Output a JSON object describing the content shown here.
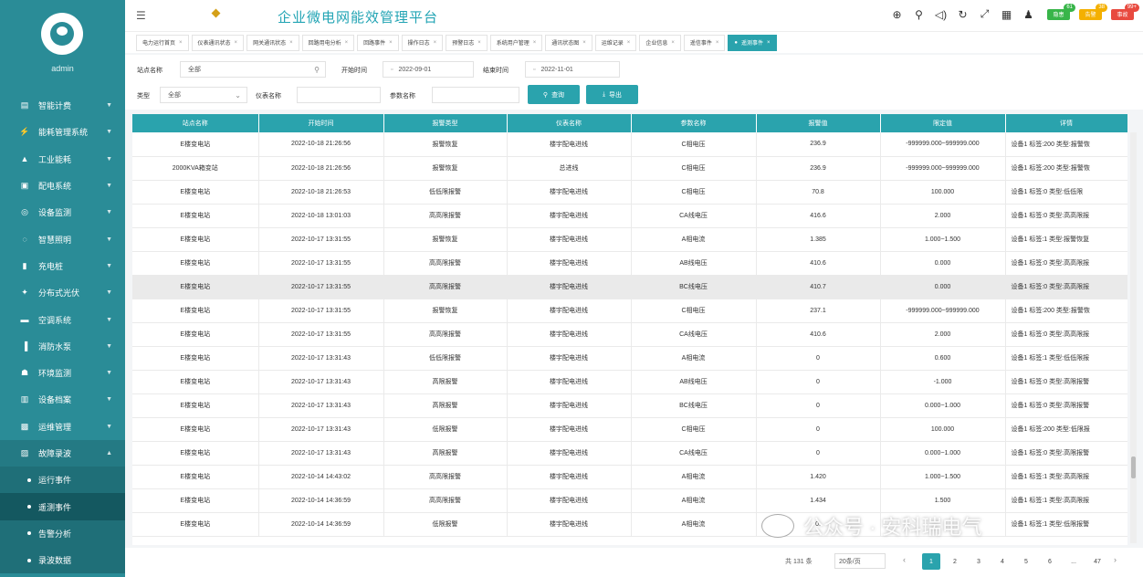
{
  "sidebar": {
    "username": "admin",
    "items": [
      {
        "label": "智能计费",
        "icon": "chart-icon"
      },
      {
        "label": "能耗管理系统",
        "icon": "bolt-icon"
      },
      {
        "label": "工业能耗",
        "icon": "factory-icon"
      },
      {
        "label": "配电系统",
        "icon": "grid-icon"
      },
      {
        "label": "设备监测",
        "icon": "monitor-icon"
      },
      {
        "label": "智慧照明",
        "icon": "bulb-icon"
      },
      {
        "label": "充电桩",
        "icon": "charger-icon"
      },
      {
        "label": "分布式光伏",
        "icon": "solar-icon"
      },
      {
        "label": "空调系统",
        "icon": "aircon-icon"
      },
      {
        "label": "消防水泵",
        "icon": "pump-icon"
      },
      {
        "label": "环境监测",
        "icon": "env-icon"
      },
      {
        "label": "设备档案",
        "icon": "archive-icon"
      },
      {
        "label": "运维管理",
        "icon": "wrench-icon"
      },
      {
        "label": "故障录波",
        "icon": "wave-icon"
      }
    ],
    "sub_items": [
      {
        "label": "运行事件"
      },
      {
        "label": "遥测事件"
      },
      {
        "label": "告警分析"
      },
      {
        "label": "录波数据"
      }
    ]
  },
  "header": {
    "title": "企业微电网能效管理平台",
    "badges": [
      {
        "label": "隐患",
        "count": "61",
        "color": "#38b549",
        "count_color": "#38b549"
      },
      {
        "label": "告警",
        "count": "38",
        "color": "#f4b000",
        "count_color": "#f4b000"
      },
      {
        "label": "事故",
        "count": "99+",
        "color": "#e84a3f",
        "count_color": "#e84a3f"
      }
    ]
  },
  "tabs": [
    {
      "label": "电力运行首页"
    },
    {
      "label": "仪表通讯状态"
    },
    {
      "label": "网关通讯状态"
    },
    {
      "label": "回路用电分析"
    },
    {
      "label": "回路事件"
    },
    {
      "label": "操作日志"
    },
    {
      "label": "预警日志"
    },
    {
      "label": "系统用户管理"
    },
    {
      "label": "通讯状态图"
    },
    {
      "label": "运维记录"
    },
    {
      "label": "企业信息"
    },
    {
      "label": "遥信事件"
    },
    {
      "label": "遥测事件"
    }
  ],
  "filters": {
    "station_label": "站点名称",
    "station_value": "全部",
    "start_label": "开始时间",
    "start_value": "2022-09-01",
    "end_label": "结束时间",
    "end_value": "2022-11-01",
    "type_label": "类型",
    "type_value": "全部",
    "meter_label": "仪表名称",
    "param_label": "参数名称",
    "search_label": "查询",
    "export_label": "导出"
  },
  "table": {
    "columns": [
      "站点名称",
      "开始时间",
      "报警类型",
      "仪表名称",
      "参数名称",
      "报警值",
      "限定值",
      "详情"
    ],
    "rows": [
      [
        "E楼变电站",
        "2022-10-18 21:26:56",
        "报警恢复",
        "楼宇配电进线",
        "C相电压",
        "236.9",
        "-999999.000~999999.000",
        "设备1 标签:200 类型:报警恢"
      ],
      [
        "2000KVA箱变站",
        "2022-10-18 21:26:56",
        "报警恢复",
        "总进线",
        "C相电压",
        "236.9",
        "-999999.000~999999.000",
        "设备1 标签:200 类型:报警恢"
      ],
      [
        "E楼变电站",
        "2022-10-18 21:26:53",
        "低低限报警",
        "楼宇配电进线",
        "C相电压",
        "70.8",
        "100.000",
        "设备1 标签:0 类型:低低限"
      ],
      [
        "E楼变电站",
        "2022-10-18 13:01:03",
        "高高限报警",
        "楼宇配电进线",
        "CA线电压",
        "416.6",
        "2.000",
        "设备1 标签:0 类型:高高限报"
      ],
      [
        "E楼变电站",
        "2022-10-17 13:31:55",
        "报警恢复",
        "楼宇配电进线",
        "A相电流",
        "1.385",
        "1.000~1.500",
        "设备1 标签:1 类型:报警恢复"
      ],
      [
        "E楼变电站",
        "2022-10-17 13:31:55",
        "高高限报警",
        "楼宇配电进线",
        "AB线电压",
        "410.6",
        "0.000",
        "设备1 标签:0 类型:高高限报"
      ],
      [
        "E楼变电站",
        "2022-10-17 13:31:55",
        "高高限报警",
        "楼宇配电进线",
        "BC线电压",
        "410.7",
        "0.000",
        "设备1 标签:0 类型:高高限报"
      ],
      [
        "E楼变电站",
        "2022-10-17 13:31:55",
        "报警恢复",
        "楼宇配电进线",
        "C相电压",
        "237.1",
        "-999999.000~999999.000",
        "设备1 标签:200 类型:报警恢"
      ],
      [
        "E楼变电站",
        "2022-10-17 13:31:55",
        "高高限报警",
        "楼宇配电进线",
        "CA线电压",
        "410.6",
        "2.000",
        "设备1 标签:0 类型:高高限报"
      ],
      [
        "E楼变电站",
        "2022-10-17 13:31:43",
        "低低限报警",
        "楼宇配电进线",
        "A相电流",
        "0",
        "0.600",
        "设备1 标签:1 类型:低低限报"
      ],
      [
        "E楼变电站",
        "2022-10-17 13:31:43",
        "高限报警",
        "楼宇配电进线",
        "AB线电压",
        "0",
        "-1.000",
        "设备1 标签:0 类型:高限报警"
      ],
      [
        "E楼变电站",
        "2022-10-17 13:31:43",
        "高限报警",
        "楼宇配电进线",
        "BC线电压",
        "0",
        "0.000~1.000",
        "设备1 标签:0 类型:高限报警"
      ],
      [
        "E楼变电站",
        "2022-10-17 13:31:43",
        "低限报警",
        "楼宇配电进线",
        "C相电压",
        "0",
        "100.000",
        "设备1 标签:200 类型:低限报"
      ],
      [
        "E楼变电站",
        "2022-10-17 13:31:43",
        "高限报警",
        "楼宇配电进线",
        "CA线电压",
        "0",
        "0.000~1.000",
        "设备1 标签:0 类型:高限报警"
      ],
      [
        "E楼变电站",
        "2022-10-14 14:43:02",
        "高高限报警",
        "楼宇配电进线",
        "A相电流",
        "1.420",
        "1.000~1.500",
        "设备1 标签:1 类型:高高限报"
      ],
      [
        "E楼变电站",
        "2022-10-14 14:36:59",
        "高高限报警",
        "楼宇配电进线",
        "A相电流",
        "1.434",
        "1.500",
        "设备1 标签:1 类型:高高限报"
      ],
      [
        "E楼变电站",
        "2022-10-14 14:36:59",
        "低限报警",
        "楼宇配电进线",
        "A相电流",
        "0.",
        "",
        "设备1 标签:1 类型:低限报警"
      ]
    ]
  },
  "pager": {
    "total": "共 131 条",
    "page_size": "20条/页",
    "pages": [
      "1",
      "2",
      "3",
      "4",
      "5",
      "6",
      "...",
      "47"
    ]
  },
  "watermark": {
    "text": "公众号 · 安科瑞电气"
  },
  "colors": {
    "sidebar": "#2a8c97",
    "accent": "#2aa3ad",
    "title": "#22a4b4"
  }
}
